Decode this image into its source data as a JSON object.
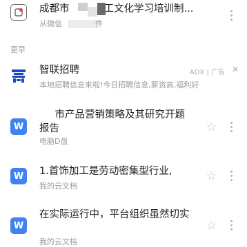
{
  "items": [
    {
      "title_pre": "成都市",
      "title_post": "工文化学习培训制...",
      "sub_pre": "从微信",
      "sub_post": "件",
      "icon": "wechat-file-icon"
    },
    {
      "title": "智联招聘",
      "ad_label": "ADX | 广告",
      "sub": "本地招聘信息来啦!今日招聘信息,薪资高,福利好",
      "icon": "zhaopin-logo-icon"
    },
    {
      "title": "超市产品营销策略及其研究开题报告",
      "sub": "电脑D盘",
      "icon": "word-doc-icon",
      "icon_letter": "W"
    },
    {
      "title": "1.首饰加工是劳动密集型行业,",
      "sub": "我的云文档",
      "icon": "word-doc-icon",
      "icon_letter": "W"
    },
    {
      "title": "在实际运行中，平台组织虽然切实",
      "sub": "我的云文档",
      "icon": "word-doc-icon",
      "icon_letter": "W"
    }
  ],
  "section_label": "更早",
  "star_glyph": "☆",
  "close_glyph": "✕",
  "colors": {
    "word_blue": "#3f82f0",
    "zhaopin_blue": "#1848c4",
    "muted_text": "#9a9a9a"
  }
}
